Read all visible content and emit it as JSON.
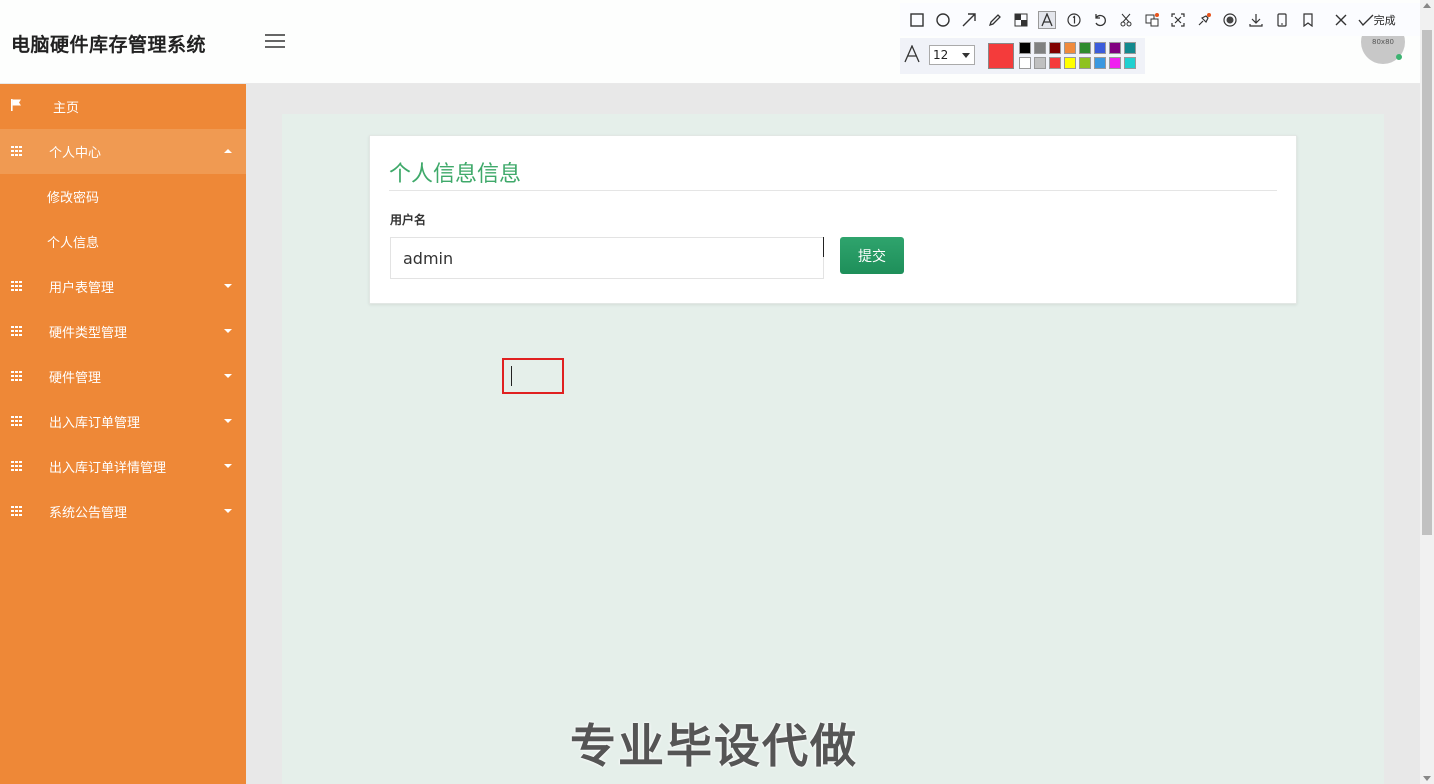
{
  "header": {
    "app_title": "电脑硬件库存管理系统",
    "avatar_text": "80x80"
  },
  "sidebar": {
    "items": [
      {
        "label": "主页",
        "icon": "flag-icon"
      },
      {
        "label": "个人中心",
        "icon": "grid-icon",
        "expanded": true,
        "children": [
          {
            "label": "修改密码"
          },
          {
            "label": "个人信息"
          }
        ]
      },
      {
        "label": "用户表管理",
        "icon": "grid-icon"
      },
      {
        "label": "硬件类型管理",
        "icon": "grid-icon"
      },
      {
        "label": "硬件管理",
        "icon": "grid-icon"
      },
      {
        "label": "出入库订单管理",
        "icon": "grid-icon"
      },
      {
        "label": "出入库订单详情管理",
        "icon": "grid-icon"
      },
      {
        "label": "系统公告管理",
        "icon": "grid-icon"
      }
    ]
  },
  "main": {
    "card_title": "个人信息信息",
    "username_label": "用户名",
    "username_value": "admin",
    "submit_label": "提交"
  },
  "watermark": "专业毕设代做",
  "toolbar": {
    "done_label": "完成",
    "font_size": "12",
    "current_color": "#f43b3b",
    "swatches_row1": [
      "#000000",
      "#808080",
      "#800000",
      "#f08a3c",
      "#2e8b2e",
      "#3b5bdb",
      "#800080",
      "#12898e"
    ],
    "swatches_row2": [
      "#ffffff",
      "#c0c0c0",
      "#f43b3b",
      "#ffff00",
      "#8ec21f",
      "#3a98e0",
      "#f020f0",
      "#1fd0d0"
    ]
  },
  "colors": {
    "sidebar_bg": "#ee8837",
    "accent_green": "#3fa96a",
    "main_bg": "#e5efea"
  }
}
